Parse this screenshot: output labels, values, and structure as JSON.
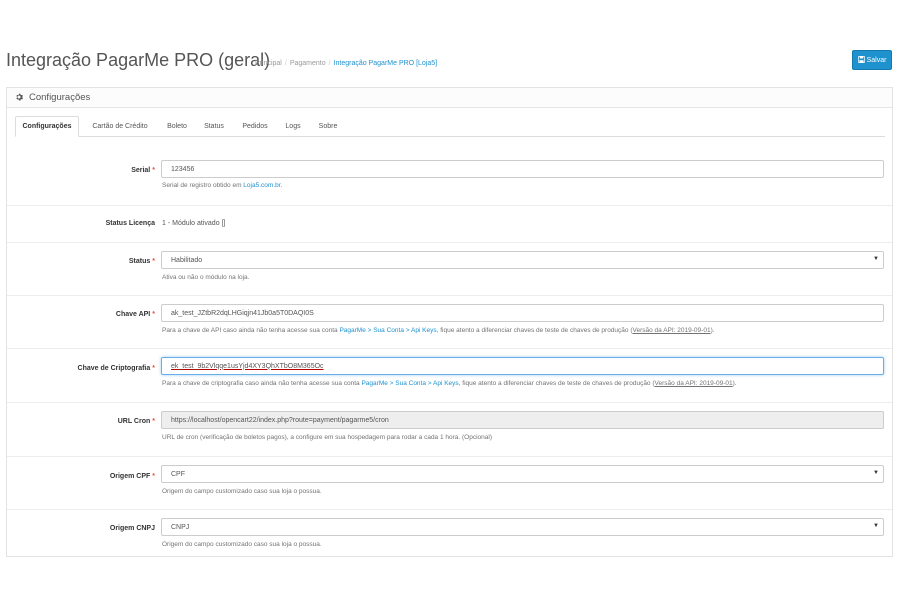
{
  "header": {
    "title": "Integração PagarMe PRO (geral)",
    "breadcrumb": [
      "Principal",
      "Pagamento",
      "Integração PagarMe PRO [Loja5]"
    ],
    "save_label": "Salvar"
  },
  "panel": {
    "heading": "Configurações",
    "tabs": [
      "Configurações",
      "Cartão de Crédito",
      "Boleto",
      "Status",
      "Pedidos",
      "Logs",
      "Sobre"
    ],
    "active_tab": "Configurações"
  },
  "fields": {
    "serial": {
      "label": "Serial",
      "value": "123456",
      "help_prefix": "Serial de registro obtido em ",
      "help_link": "Loja5.com.br",
      "help_suffix": "."
    },
    "license": {
      "label": "Status Licença",
      "value": "1 - Módulo ativado []"
    },
    "status": {
      "label": "Status",
      "value": "Habilitado",
      "help": "Ativa ou não o módulo na loja."
    },
    "api_key": {
      "label": "Chave API",
      "value": "ak_test_JZtbR2dqLHGiqjn41Jb0a5T0DAQI0S",
      "help_prefix": "Para a chave de API caso ainda não tenha acesse sua conta ",
      "help_link": "PagarMe > Sua Conta > Api Keys",
      "help_middle": ", fique atento a diferenciar chaves de teste de chaves de produção (",
      "help_version": "Versão da API: 2019-09-01",
      "help_suffix": ")."
    },
    "crypto_key": {
      "label": "Chave de Criptografia",
      "value": "ek_test_9b2Vlqqe1usYjd4XY3QhXTbO8M365Oc",
      "help_prefix": "Para a chave de criptografia caso ainda não tenha acesse sua conta ",
      "help_link": "PagarMe > Sua Conta > Api Keys",
      "help_middle": ", fique atento a diferenciar chaves de teste de chaves de produção (",
      "help_version": "Versão da API: 2019-09-01",
      "help_suffix": ")."
    },
    "cron_url": {
      "label": "URL Cron",
      "value": "https://localhost/opencart22/index.php?route=payment/pagarme5/cron",
      "help": "URL de cron (verificação de boletos pagos), a configure em sua hospedagem para rodar a cada 1 hora. (Opcional)"
    },
    "cpf_origin": {
      "label": "Origem CPF",
      "value": "CPF",
      "help": "Origem do campo customizado caso sua loja o possua."
    },
    "cnpj_origin": {
      "label": "Origem CNPJ",
      "value": "CNPJ",
      "help": "Origem do campo customizado caso sua loja o possua."
    }
  },
  "colors": {
    "primary": "#1e91cf",
    "required": "#e3503e"
  }
}
